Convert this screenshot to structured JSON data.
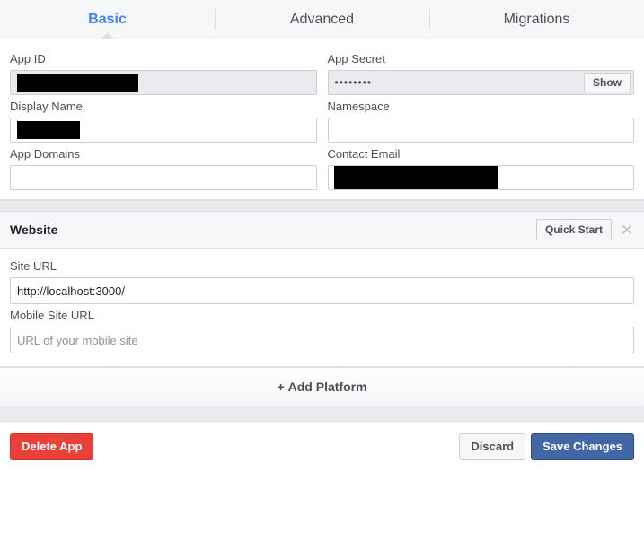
{
  "tabs": [
    {
      "label": "Basic",
      "active": true
    },
    {
      "label": "Advanced",
      "active": false
    },
    {
      "label": "Migrations",
      "active": false
    }
  ],
  "basic": {
    "app_id": {
      "label": "App ID",
      "value": "",
      "redacted": true,
      "readonly": true
    },
    "app_secret": {
      "label": "App Secret",
      "value": "••••••••",
      "show_button_label": "Show",
      "readonly": true
    },
    "display_name": {
      "label": "Display Name",
      "value": "",
      "redacted": true
    },
    "namespace": {
      "label": "Namespace",
      "value": "",
      "placeholder": ""
    },
    "app_domains": {
      "label": "App Domains",
      "value": "",
      "placeholder": ""
    },
    "contact_email": {
      "label": "Contact Email",
      "value": "",
      "redacted": true
    }
  },
  "website_section": {
    "title": "Website",
    "quick_start_label": "Quick Start",
    "close_icon": "close-icon",
    "site_url": {
      "label": "Site URL",
      "value": "http://localhost:3000/"
    },
    "mobile_site_url": {
      "label": "Mobile Site URL",
      "value": "",
      "placeholder": "URL of your mobile site"
    }
  },
  "add_platform": {
    "plus": "+",
    "label": "Add Platform"
  },
  "footer": {
    "delete_label": "Delete App",
    "discard_label": "Discard",
    "save_label": "Save Changes"
  },
  "colors": {
    "active_tab": "#4080ff",
    "save_button": "#4267a7",
    "delete_button": "#e9413a",
    "panel_bg": "#e9ebee",
    "header_bg": "#f6f7f8",
    "border": "#dddfe2"
  }
}
